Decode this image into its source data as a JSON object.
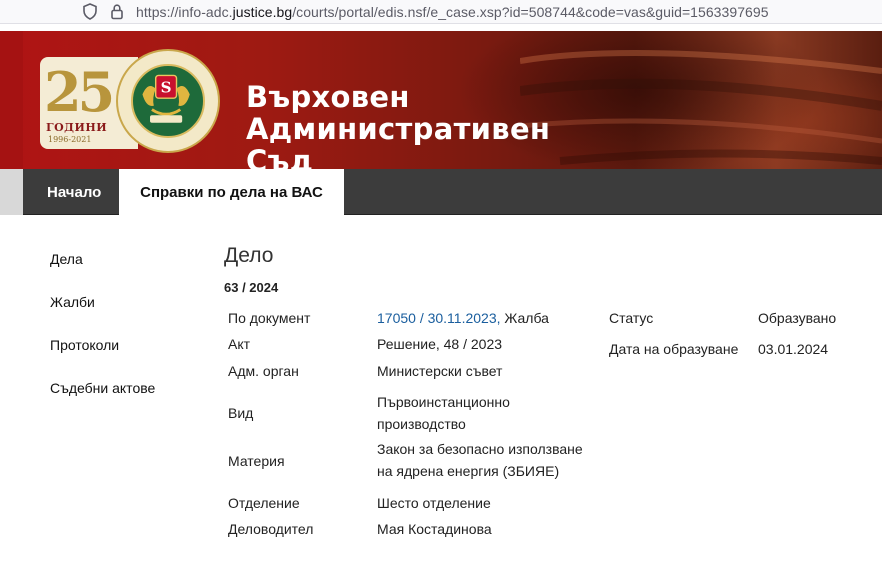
{
  "browser": {
    "url_prefix": "https://info-adc.",
    "url_host": "justice.bg",
    "url_path": "/courts/portal/edis.nsf/e_case.xsp?id=508744&code=vas&guid=1563397695"
  },
  "header": {
    "title_line1": "Върховен",
    "title_line2": "Административен",
    "title_line3": "Съд",
    "logo_number": "25",
    "logo_years": "ГОДИНИ",
    "logo_dates": "1996-2021"
  },
  "nav": {
    "home": "Начало",
    "cases": "Справки по дела на ВАС"
  },
  "sidebar": {
    "items": [
      "Дела",
      "Жалби",
      "Протоколи",
      "Съдебни актове"
    ]
  },
  "case": {
    "heading": "Дело",
    "number": "63 / 2024",
    "labels": {
      "document": "По документ",
      "act": "Акт",
      "authority": "Адм. орган",
      "kind": "Вид",
      "subject": "Материя",
      "department": "Отделение",
      "clerk": "Деловодител",
      "status": "Статус",
      "created": "Дата на образуване"
    },
    "values": {
      "document_link": "17050 / 30.11.2023,",
      "document_type": " Жалба",
      "act": "Решение, 48 /  2023",
      "authority": "Министерски съвет",
      "kind_line1": "Първоинстанционно",
      "kind_line2": "производство",
      "subject_line1": "Закон за безопасно използване",
      "subject_line2": "на ядрена енергия (ЗБИЯЕ)",
      "department": "Шесто отделение",
      "clerk": "Мая Костадинова",
      "status": "Образувано",
      "created": "03.01.2024"
    }
  },
  "colors": {
    "banner_red": "#a51212",
    "nav_dark": "#3c3c3c",
    "link_blue": "#1a5e9e"
  }
}
